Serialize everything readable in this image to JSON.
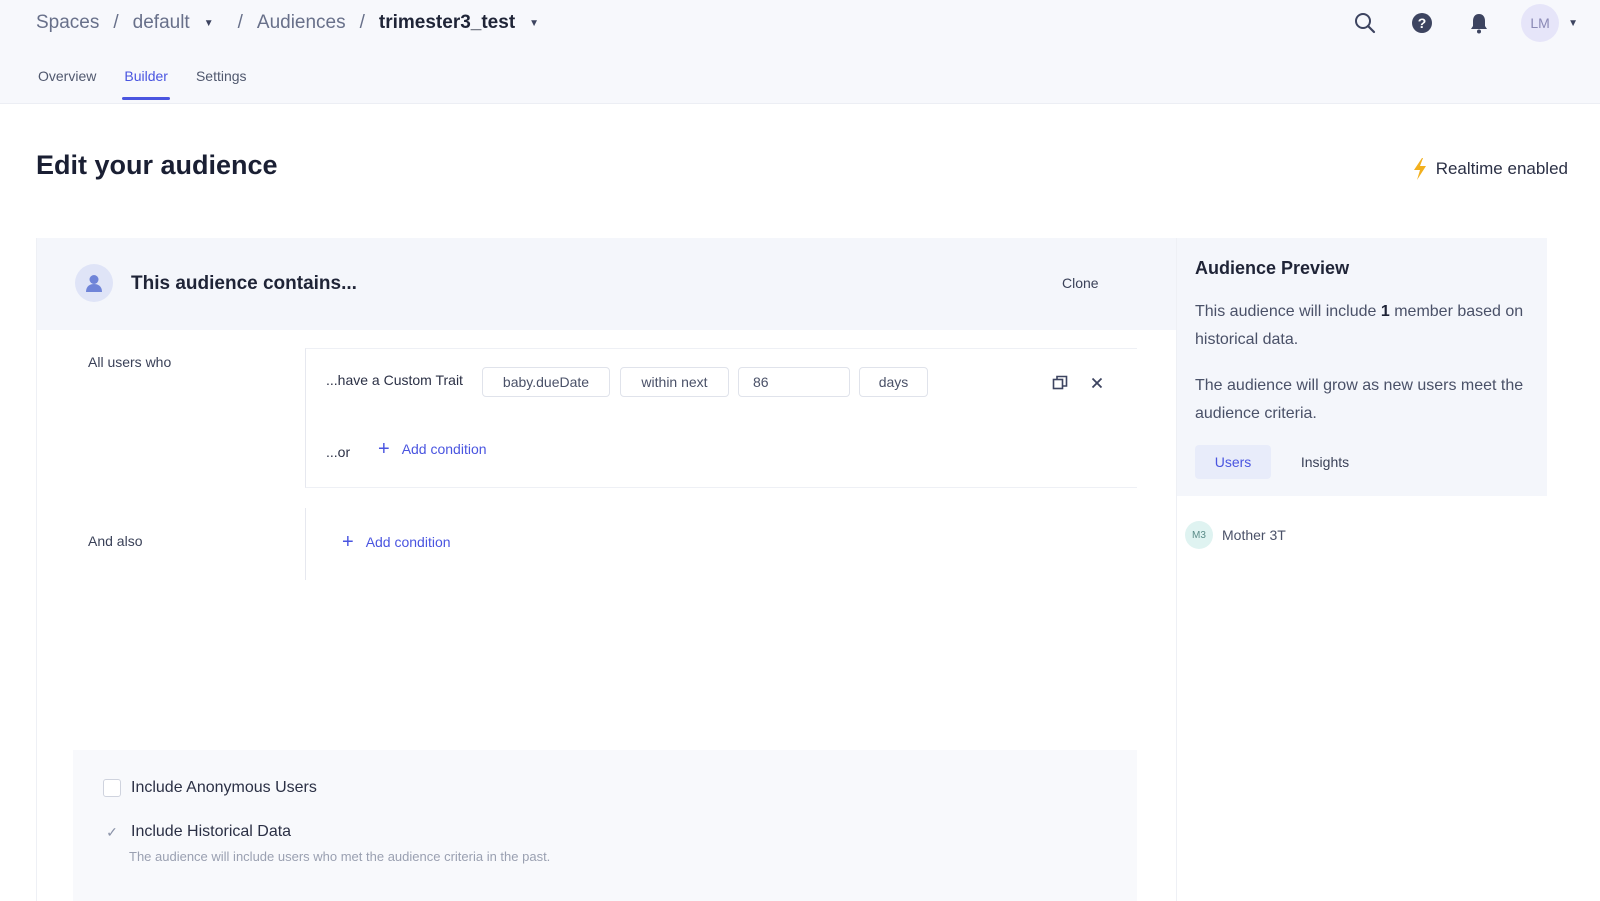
{
  "breadcrumb": {
    "spaces": "Spaces",
    "workspace": "default",
    "audiences": "Audiences",
    "current": "trimester3_test"
  },
  "user": {
    "initials": "LM"
  },
  "tabs": [
    {
      "label": "Overview",
      "active": false
    },
    {
      "label": "Builder",
      "active": true
    },
    {
      "label": "Settings",
      "active": false
    }
  ],
  "page": {
    "title": "Edit your audience",
    "realtime_label": "Realtime enabled"
  },
  "builder": {
    "header_title": "This audience contains...",
    "clone_label": "Clone",
    "all_users_label": "All users who",
    "condition": {
      "prefix": "...have a Custom Trait",
      "trait": "baby.dueDate",
      "operator": "within next",
      "value": "86",
      "unit": "days"
    },
    "or_label": "...or",
    "add_condition_label": "Add condition",
    "and_also_label": "And also",
    "include_anonymous_label": "Include Anonymous Users",
    "include_historical_label": "Include Historical Data",
    "include_historical_help": "The audience will include users who met the audience criteria in the past."
  },
  "preview": {
    "title": "Audience Preview",
    "text1_before": "This audience will include ",
    "member_count": "1",
    "text1_after": " member based on historical data.",
    "text2": "The audience will grow as new users meet the audience criteria.",
    "tab_users": "Users",
    "tab_insights": "Insights",
    "members": [
      {
        "initials": "M3",
        "name": "Mother 3T"
      }
    ]
  },
  "colors": {
    "accent": "#4a55e0",
    "lightning": "#f2b01e"
  },
  "icons": [
    "search-icon",
    "help-icon",
    "bell-icon",
    "lightning-icon",
    "person-icon",
    "duplicate-icon",
    "close-icon",
    "plus-icon",
    "check-icon"
  ]
}
